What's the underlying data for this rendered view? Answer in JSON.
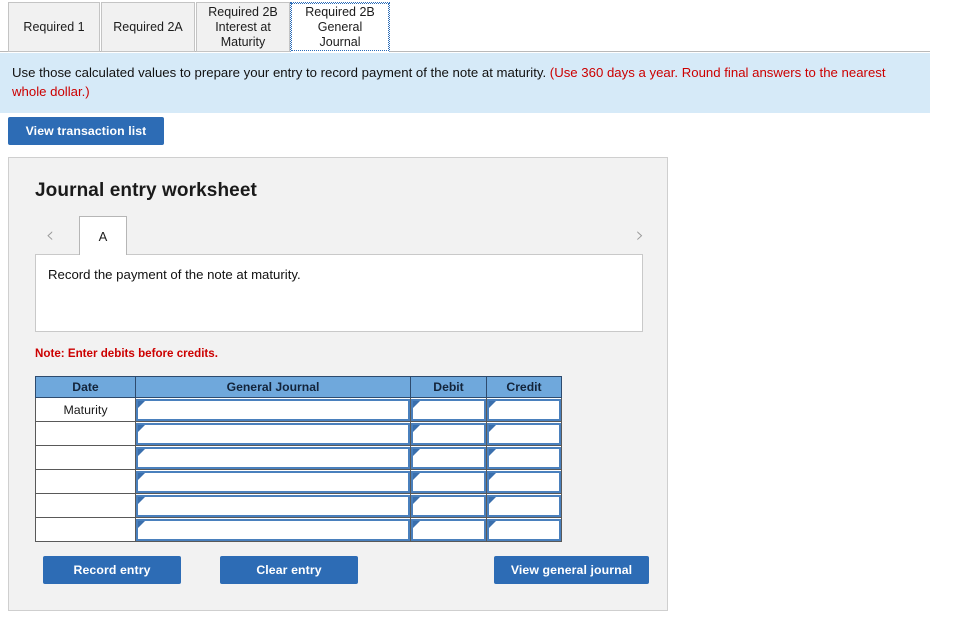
{
  "tabs": [
    {
      "label": "Required 1",
      "active": false
    },
    {
      "label": "Required 2A",
      "active": false
    },
    {
      "label": "Required 2B Interest at Maturity",
      "active": false
    },
    {
      "label": "Required 2B General Journal",
      "active": true
    }
  ],
  "banner": {
    "text": "Use those calculated values to prepare your entry to record payment of the note at maturity. ",
    "highlight": "(Use 360 days a year. Round final answers to the nearest whole dollar.)"
  },
  "toolbar": {
    "view_transaction_list": "View transaction list"
  },
  "worksheet": {
    "title": "Journal entry worksheet",
    "prev_icon": "chevron-left-icon",
    "next_icon": "chevron-right-icon",
    "tab_label": "A",
    "description": "Record the payment of the note at maturity.",
    "note": "Note: Enter debits before credits.",
    "columns": [
      "Date",
      "General Journal",
      "Debit",
      "Credit"
    ],
    "rows": [
      {
        "date": "Maturity",
        "general_journal": "",
        "debit": "",
        "credit": ""
      },
      {
        "date": "",
        "general_journal": "",
        "debit": "",
        "credit": ""
      },
      {
        "date": "",
        "general_journal": "",
        "debit": "",
        "credit": ""
      },
      {
        "date": "",
        "general_journal": "",
        "debit": "",
        "credit": ""
      },
      {
        "date": "",
        "general_journal": "",
        "debit": "",
        "credit": ""
      },
      {
        "date": "",
        "general_journal": "",
        "debit": "",
        "credit": ""
      }
    ],
    "buttons": {
      "record_entry": "Record entry",
      "clear_entry": "Clear entry",
      "view_general_journal": "View general journal"
    }
  },
  "colors": {
    "accent_blue": "#2d6cb5",
    "banner_bg": "#d6eaf8",
    "table_header_bg": "#6fa8dc",
    "warning_red": "#cc0000",
    "panel_bg": "#f2f2f2"
  }
}
